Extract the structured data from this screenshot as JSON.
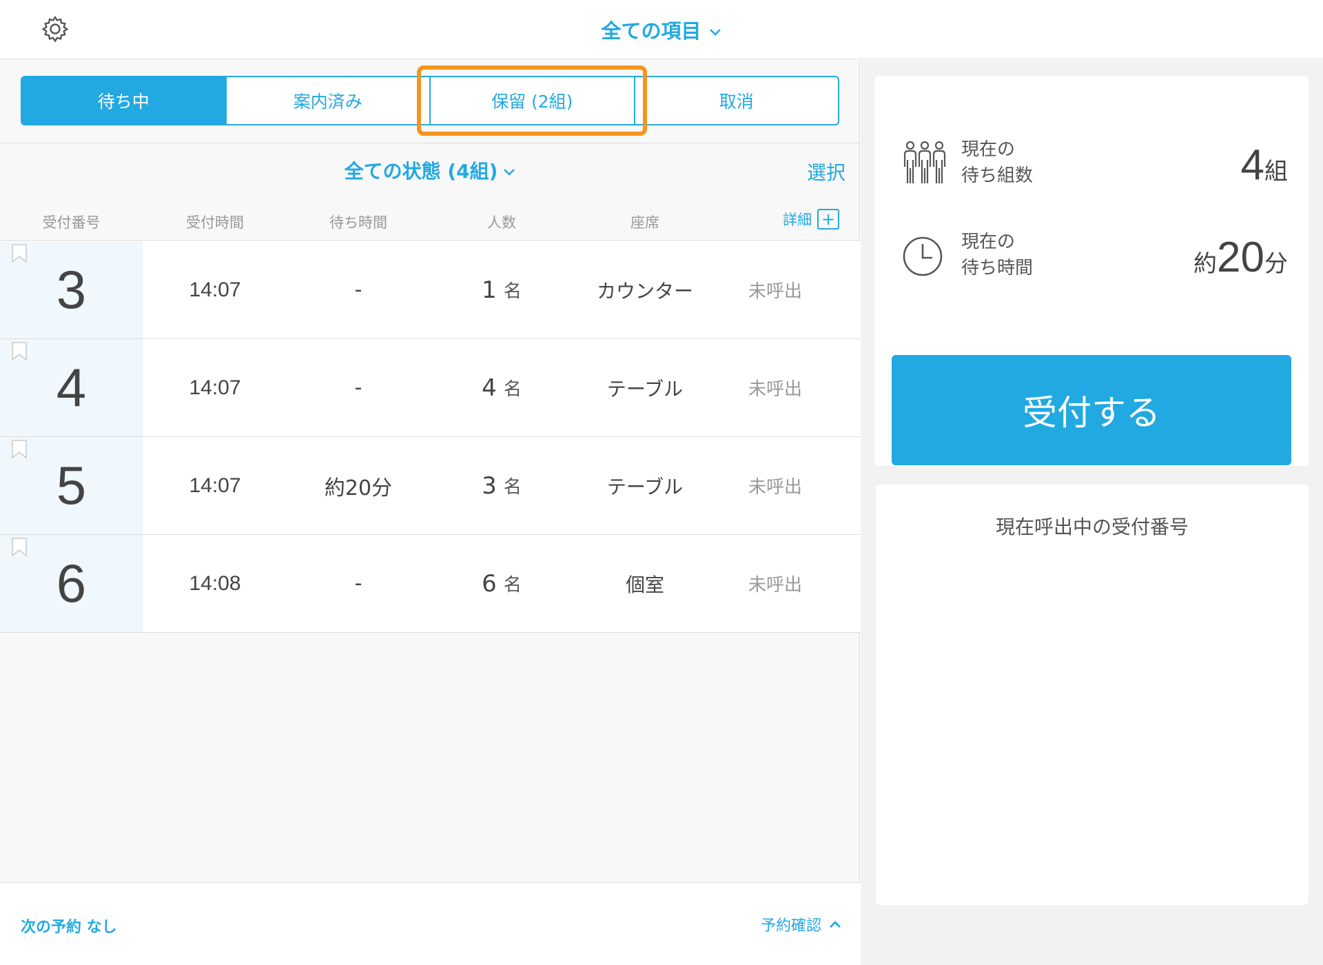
{
  "header": {
    "title": "全ての項目"
  },
  "tabs": [
    {
      "label": "待ち中",
      "active": true
    },
    {
      "label": "案内済み",
      "active": false
    },
    {
      "label": "保留 (2組)",
      "active": false
    },
    {
      "label": "取消",
      "active": false
    }
  ],
  "filter": {
    "status_label": "全ての状態 (4組)",
    "select_label": "選択"
  },
  "columns": {
    "number": "受付番号",
    "time": "受付時間",
    "wait": "待ち時間",
    "party": "人数",
    "seat": "座席",
    "detail": "詳細"
  },
  "rows": [
    {
      "number": "3",
      "time": "14:07",
      "wait": "-",
      "party": "1",
      "unit": "名",
      "seat": "カウンター",
      "call": "未呼出"
    },
    {
      "number": "4",
      "time": "14:07",
      "wait": "-",
      "party": "4",
      "unit": "名",
      "seat": "テーブル",
      "call": "未呼出"
    },
    {
      "number": "5",
      "time": "14:07",
      "wait": "約20分",
      "party": "3",
      "unit": "名",
      "seat": "テーブル",
      "call": "未呼出"
    },
    {
      "number": "6",
      "time": "14:08",
      "wait": "-",
      "party": "6",
      "unit": "名",
      "seat": "個室",
      "call": "未呼出"
    }
  ],
  "footer": {
    "next_reservation": "次の予約 なし",
    "reservation_confirm": "予約確認"
  },
  "stats": {
    "groups_label_1": "現在の",
    "groups_label_2": "待ち組数",
    "groups_value": "4",
    "groups_unit": "組",
    "wait_label_1": "現在の",
    "wait_label_2": "待ち時間",
    "wait_prefix": "約",
    "wait_value": "20",
    "wait_unit": "分"
  },
  "register_button": "受付する",
  "calling": {
    "title": "現在呼出中の受付番号"
  },
  "colors": {
    "accent": "#22a9e2",
    "highlight": "#f7941d"
  }
}
